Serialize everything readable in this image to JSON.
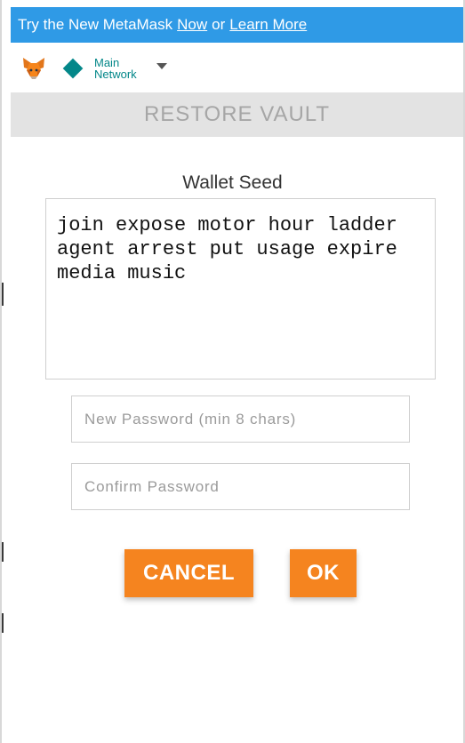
{
  "banner": {
    "prefix": "Try the New MetaMask",
    "now_link": "Now",
    "middle": "or",
    "learn_link": "Learn More"
  },
  "topbar": {
    "logo_icon": "metamask-fox-icon",
    "network_icon": "diamond-icon",
    "network_line1": "Main",
    "network_line2": "Network",
    "network_color": "#038789"
  },
  "page": {
    "title": "RESTORE VAULT"
  },
  "form": {
    "seed_label": "Wallet Seed",
    "seed_value": "join expose motor hour ladder agent arrest put usage expire media music",
    "new_password_placeholder": "New Password (min 8 chars)",
    "confirm_password_placeholder": "Confirm Password"
  },
  "actions": {
    "cancel_label": "CANCEL",
    "ok_label": "OK",
    "button_color": "#f5841f"
  },
  "colors": {
    "banner": "#2f9ae6",
    "title_bar": "#e3e3e3"
  }
}
